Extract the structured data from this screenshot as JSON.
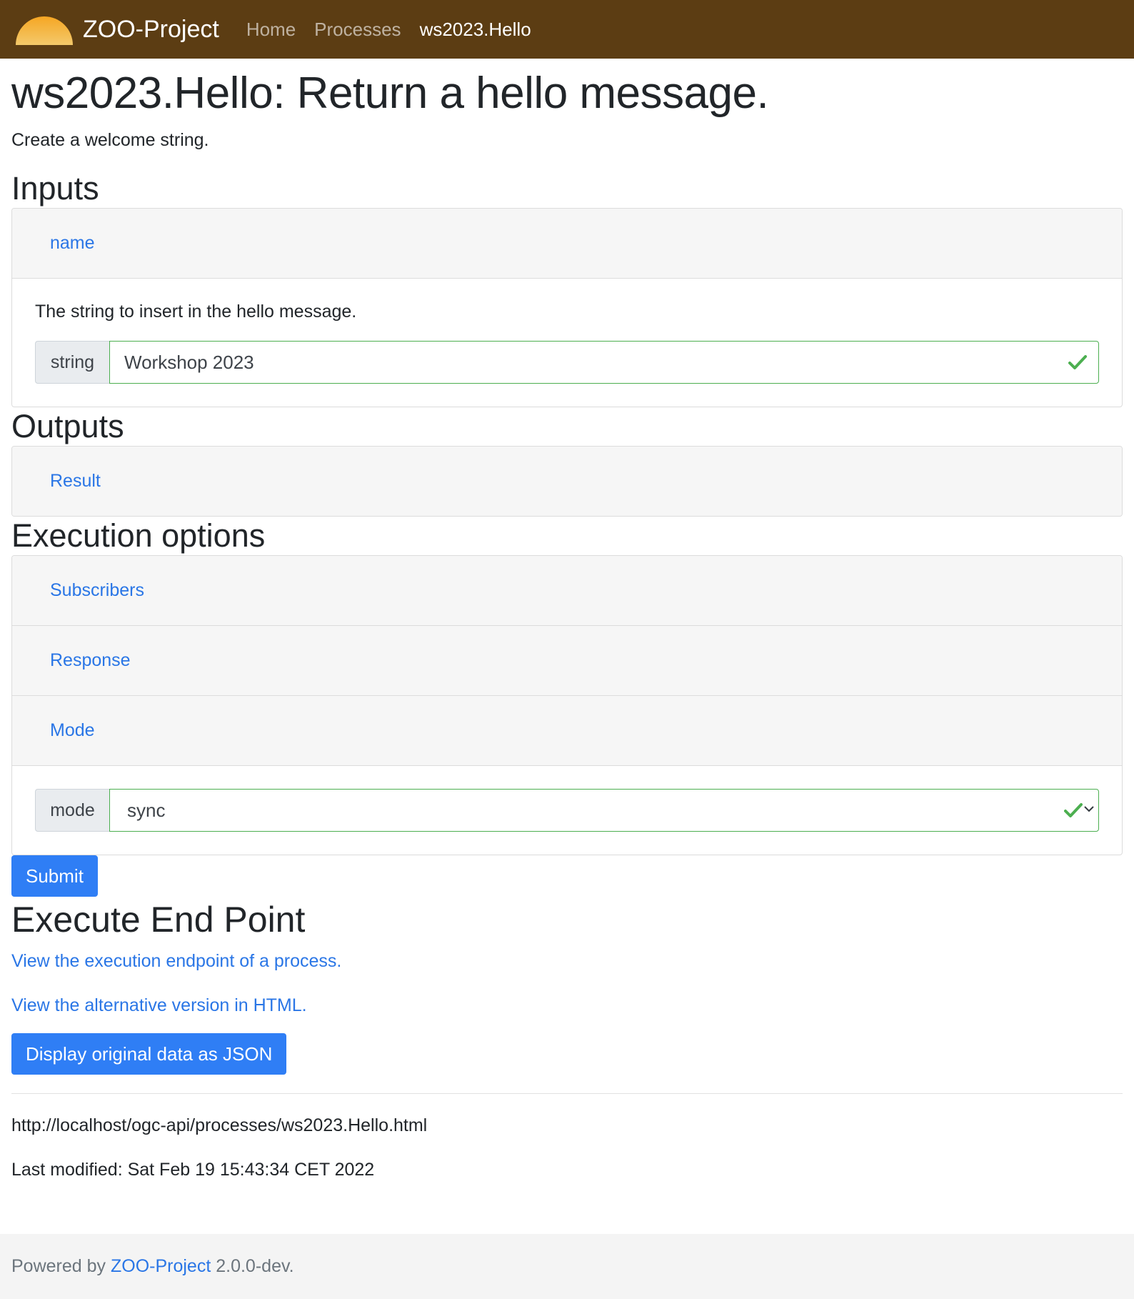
{
  "navbar": {
    "brand": "ZOO-Project",
    "links": [
      "Home",
      "Processes"
    ],
    "active": "ws2023.Hello"
  },
  "page": {
    "title": "ws2023.Hello: Return a hello message.",
    "description": "Create a welcome string."
  },
  "inputs": {
    "heading": "Inputs",
    "fields": [
      {
        "name": "name",
        "description": "The string to insert in the hello message.",
        "type": "string",
        "value": "Workshop 2023"
      }
    ]
  },
  "outputs": {
    "heading": "Outputs",
    "items": [
      "Result"
    ]
  },
  "execution": {
    "heading": "Execution options",
    "items": [
      "Subscribers",
      "Response",
      "Mode"
    ],
    "mode_label": "mode",
    "mode_value": "sync",
    "submit": "Submit"
  },
  "endpoint": {
    "heading": "Execute End Point",
    "link1": "View the execution endpoint of a process.",
    "link2": "View the alternative version in HTML.",
    "json_button": "Display original data as JSON"
  },
  "meta": {
    "url": "http://localhost/ogc-api/processes/ws2023.Hello.html",
    "last_modified": "Last modified: Sat Feb 19 15:43:34 CET 2022"
  },
  "footer": {
    "prefix": "Powered by",
    "link": "ZOO-Project",
    "suffix": "2.0.0-dev."
  },
  "colors": {
    "navbar": "#5c3d13",
    "link": "#2a76e6",
    "button": "#2f7ef5",
    "valid": "#4caf50"
  }
}
